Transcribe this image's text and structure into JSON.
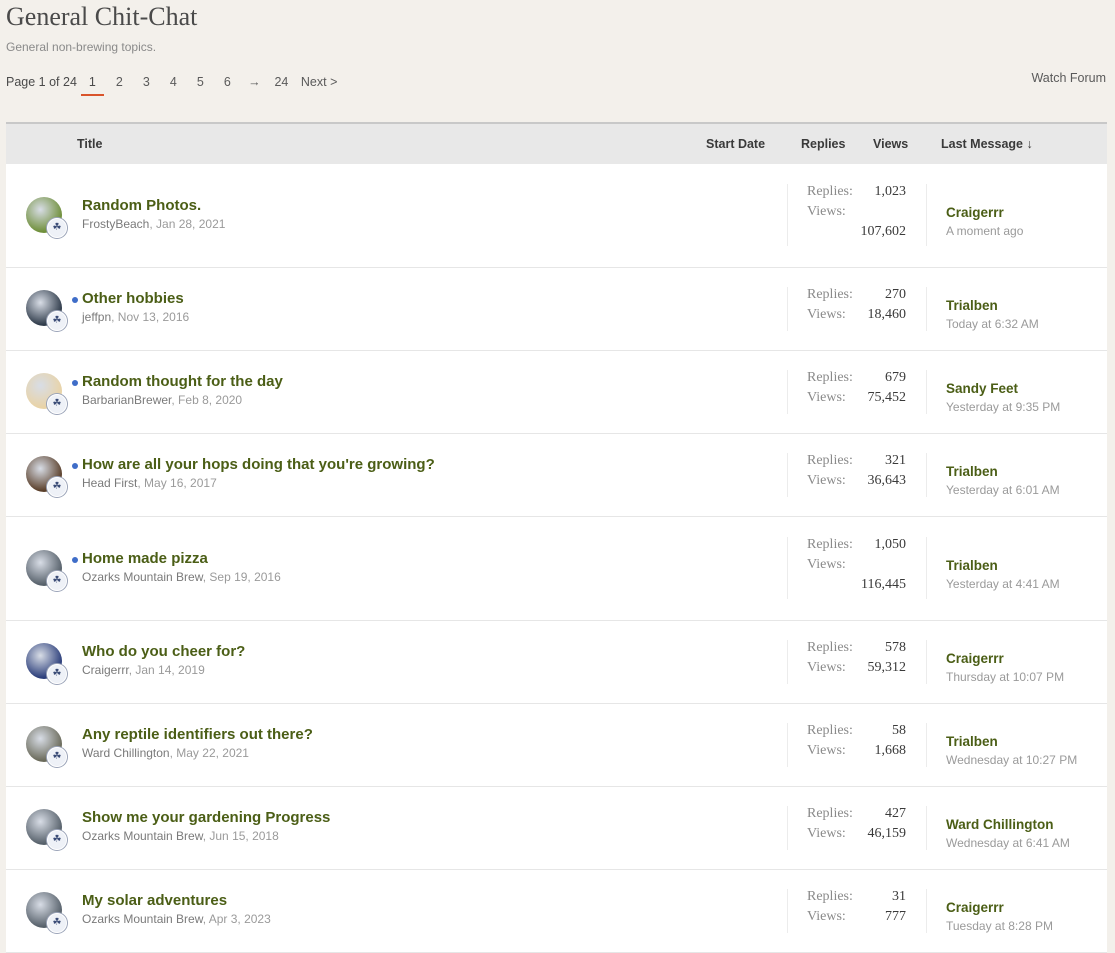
{
  "forum": {
    "title": "General Chit-Chat",
    "description": "General non-brewing topics.",
    "watch_label": "Watch Forum"
  },
  "pagination": {
    "label": "Page 1 of 24",
    "pages": [
      "1",
      "2",
      "3",
      "4",
      "5",
      "6"
    ],
    "current": "1",
    "arrow": "→",
    "last": "24",
    "next": "Next >"
  },
  "columns": {
    "title": "Title",
    "start_date": "Start Date",
    "replies": "Replies",
    "views": "Views",
    "last_message": "Last Message ↓"
  },
  "stat_labels": {
    "replies": "Replies:",
    "views": "Views:"
  },
  "threads": [
    {
      "title": "Random Photos.",
      "author": "FrostyBeach",
      "date": ", Jan 28, 2021",
      "replies": "1,023",
      "views": "107,602",
      "last_user": "Craigerrr",
      "last_time": "A moment ago",
      "unread": false,
      "avatar_color": "#6f8f3a"
    },
    {
      "title": "Other hobbies",
      "author": "jeffpn",
      "date": ", Nov 13, 2016",
      "replies": "270",
      "views": "18,460",
      "last_user": "Trialben",
      "last_time": "Today at 6:32 AM",
      "unread": true,
      "avatar_color": "#2f3b4a"
    },
    {
      "title": "Random thought for the day",
      "author": "BarbarianBrewer",
      "date": ", Feb 8, 2020",
      "replies": "679",
      "views": "75,452",
      "last_user": "Sandy Feet",
      "last_time": "Yesterday at 9:35 PM",
      "unread": true,
      "avatar_color": "#e9d3a6"
    },
    {
      "title": "How are all your hops doing that you're growing?",
      "author": "Head First",
      "date": ", May 16, 2017",
      "replies": "321",
      "views": "36,643",
      "last_user": "Trialben",
      "last_time": "Yesterday at 6:01 AM",
      "unread": true,
      "avatar_color": "#5a3f2a"
    },
    {
      "title": "Home made pizza",
      "author": "Ozarks Mountain Brew",
      "date": ", Sep 19, 2016",
      "replies": "1,050",
      "views": "116,445",
      "last_user": "Trialben",
      "last_time": "Yesterday at 4:41 AM",
      "unread": true,
      "avatar_color": "#56606a"
    },
    {
      "title": "Who do you cheer for?",
      "author": "Craigerrr",
      "date": ", Jan 14, 2019",
      "replies": "578",
      "views": "59,312",
      "last_user": "Craigerrr",
      "last_time": "Thursday at 10:07 PM",
      "unread": false,
      "avatar_color": "#2a3d7a"
    },
    {
      "title": "Any reptile identifiers out there?",
      "author": "Ward Chillington",
      "date": ", May 22, 2021",
      "replies": "58",
      "views": "1,668",
      "last_user": "Trialben",
      "last_time": "Wednesday at 10:27 PM",
      "unread": false,
      "avatar_color": "#6a6a5a"
    },
    {
      "title": "Show me your gardening Progress",
      "author": "Ozarks Mountain Brew",
      "date": ", Jun 15, 2018",
      "replies": "427",
      "views": "46,159",
      "last_user": "Ward Chillington",
      "last_time": "Wednesday at 6:41 AM",
      "unread": false,
      "avatar_color": "#56606a"
    },
    {
      "title": "My solar adventures",
      "author": "Ozarks Mountain Brew",
      "date": ", Apr 3, 2023",
      "replies": "31",
      "views": "777",
      "last_user": "Craigerrr",
      "last_time": "Tuesday at 8:28 PM",
      "unread": false,
      "avatar_color": "#56606a"
    }
  ],
  "icons": {
    "badge": "maple-leaf-badge-icon",
    "unread": "unread-dot-icon"
  }
}
